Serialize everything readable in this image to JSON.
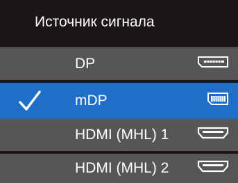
{
  "menu": {
    "title": "Источник сигнала",
    "items": [
      {
        "label": "DP",
        "icon": "dp-port-icon",
        "selected": false
      },
      {
        "label": "mDP",
        "icon": "mini-dp-port-icon",
        "selected": true
      },
      {
        "label": "HDMI (MHL) 1",
        "icon": "hdmi-port-icon",
        "selected": false
      },
      {
        "label": "HDMI (MHL) 2",
        "icon": "hdmi-port-icon",
        "selected": false
      }
    ]
  },
  "colors": {
    "background": "#1c1616",
    "row": "#565656",
    "selected": "#1f6ec7",
    "text": "#ffffff"
  }
}
